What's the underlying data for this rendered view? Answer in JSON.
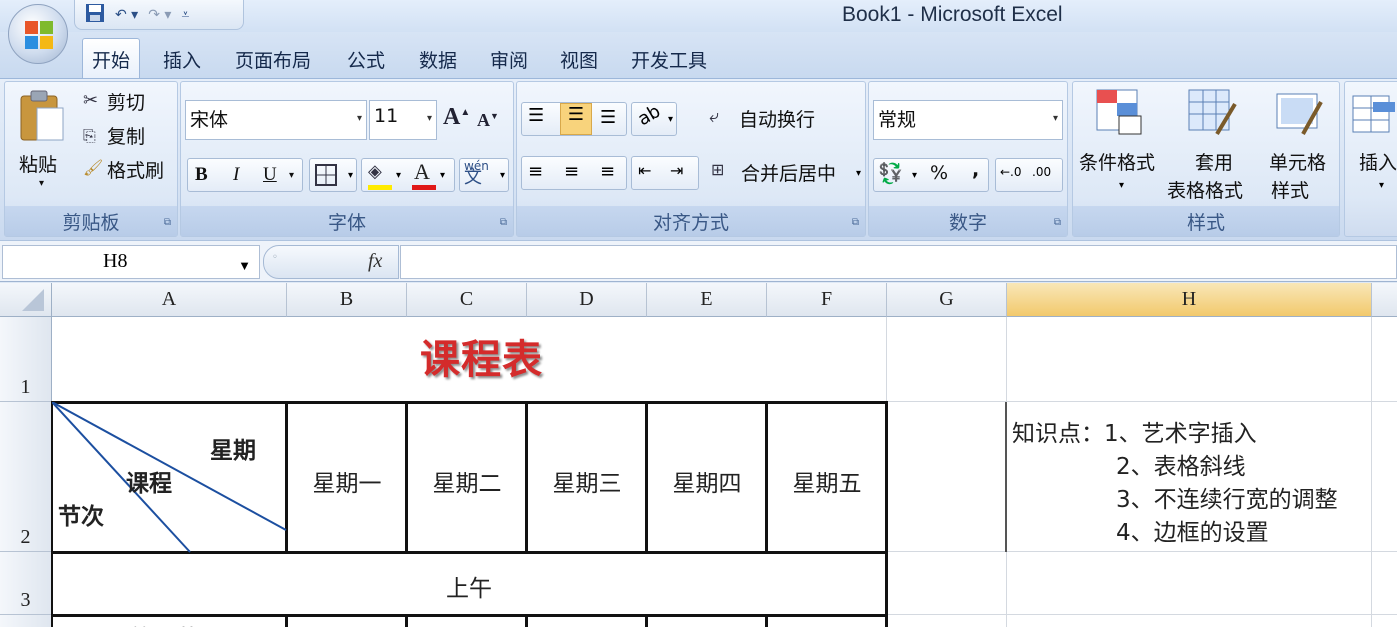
{
  "window": {
    "title": "Book1 - Microsoft Excel"
  },
  "tabs": [
    "开始",
    "插入",
    "页面布局",
    "公式",
    "数据",
    "审阅",
    "视图",
    "开发工具"
  ],
  "ribbon": {
    "clipboard": {
      "paste": "粘贴",
      "cut": "剪切",
      "copy": "复制",
      "format_painter": "格式刷",
      "label": "剪贴板"
    },
    "font": {
      "name": "宋体",
      "size": "11",
      "bold": "B",
      "italic": "I",
      "underline": "U",
      "font_color": "A",
      "label": "字体"
    },
    "alignment": {
      "wrap": "自动换行",
      "merge": "合并后居中",
      "label": "对齐方式"
    },
    "number": {
      "format": "常规",
      "percent": "%",
      "comma": ",",
      "label": "数字"
    },
    "styles": {
      "conditional": "条件格式",
      "table_format_1": "套用",
      "table_format_2": "表格格式",
      "cell_style_1": "单元格",
      "cell_style_2": "样式",
      "label": "样式"
    },
    "cells": {
      "insert": "插入"
    }
  },
  "formula_bar": {
    "name_box": "H8",
    "fx": "fx",
    "content": ""
  },
  "columns": [
    "A",
    "B",
    "C",
    "D",
    "E",
    "F",
    "G",
    "H"
  ],
  "rows": [
    "1",
    "2",
    "3"
  ],
  "sheet": {
    "title": "课程表",
    "diag_week": "星期",
    "diag_course": "课程",
    "diag_period": "节次",
    "days": [
      "星期一",
      "星期二",
      "星期三",
      "星期四",
      "星期五"
    ],
    "morning": "上午",
    "row4_partial": "第一节",
    "notes": [
      "知识点：1、艺术字插入",
      "2、表格斜线",
      "3、不连续行宽的调整",
      "4、边框的设置"
    ]
  },
  "colors": {
    "title_red": "#d42b2b",
    "ribbon_blue": "#dfe9f5"
  }
}
